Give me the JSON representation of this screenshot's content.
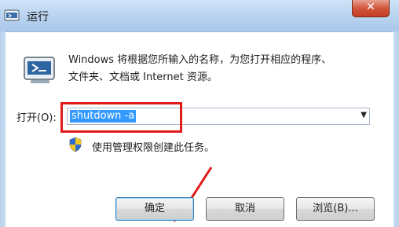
{
  "window": {
    "title": "运行",
    "close_label": "✕"
  },
  "description": {
    "line1": "Windows 将根据您所输入的名称，为您打开相应的程序、",
    "line2": "文件夹、文档或 Internet 资源。"
  },
  "open_field": {
    "label": "打开(O):",
    "value": "shutdown -a"
  },
  "admin_note": "使用管理权限创建此任务。",
  "buttons": {
    "ok": "确定",
    "cancel": "取消",
    "browse": "浏览(B)..."
  },
  "colors": {
    "highlight": "#e11b1b",
    "selection": "#3399ff"
  },
  "icons": {
    "title": "run-icon",
    "dialog": "run-icon",
    "shield": "uac-shield-icon",
    "dropdown": "chevron-down-icon"
  }
}
